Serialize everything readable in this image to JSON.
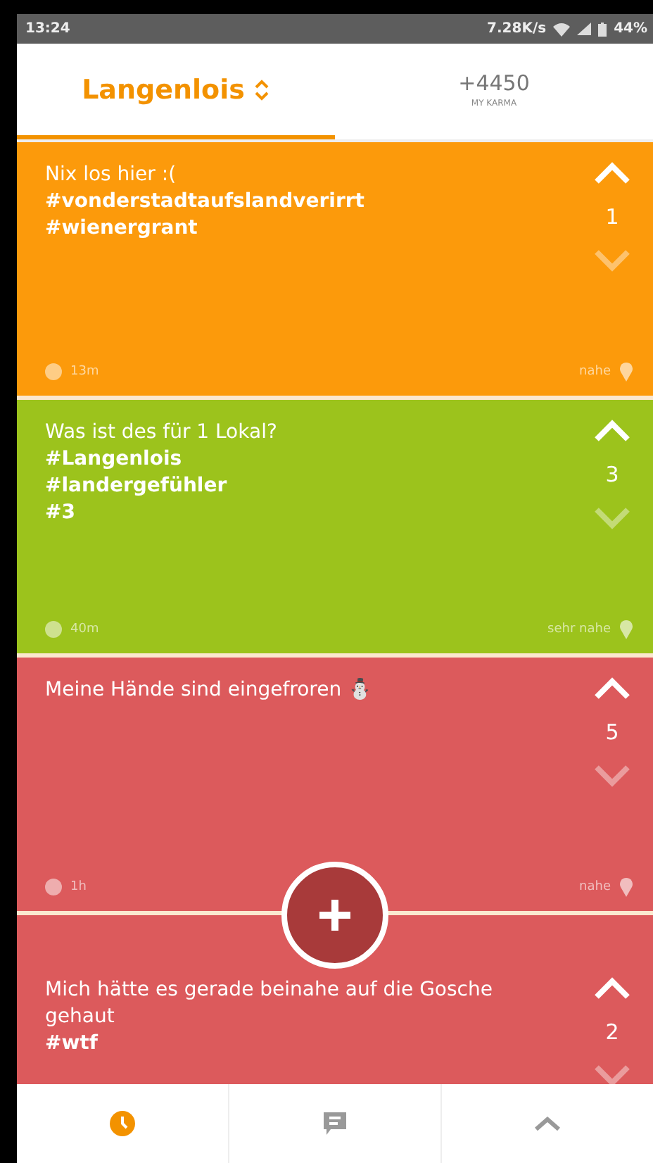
{
  "status_bar": {
    "time": "13:24",
    "speed": "7.28K/s",
    "battery": "44%"
  },
  "tabs": [
    {
      "kind": "location",
      "label": "Langenlois",
      "selected": true
    },
    {
      "kind": "karma",
      "label": "+4450",
      "sublabel": "MY KARMA",
      "selected": false
    }
  ],
  "posts": [
    {
      "color": "#fc9a0b",
      "lines": [
        {
          "text": "Nix los hier :(",
          "bold": false
        },
        {
          "text": "#vonderstadtaufslandverirrt",
          "bold": true
        },
        {
          "text": "#wienergrant",
          "bold": true
        }
      ],
      "votes": "1",
      "time": "13m",
      "distance": "nahe"
    },
    {
      "color": "#9cc31c",
      "lines": [
        {
          "text": "Was ist des für 1 Lokal?",
          "bold": false
        },
        {
          "text": "#Langenlois",
          "bold": true
        },
        {
          "text": "#landergefühler",
          "bold": true
        },
        {
          "text": "#3",
          "bold": true
        }
      ],
      "votes": "3",
      "time": "40m",
      "distance": "sehr nahe"
    },
    {
      "color": "#dc5a5c",
      "lines": [
        {
          "text": "Meine Hände sind eingefroren ⛄",
          "bold": false
        }
      ],
      "votes": "5",
      "time": "1h",
      "distance": "nahe"
    },
    {
      "color": "#dc5a5c",
      "lines": [
        {
          "text": "Mich hätte es gerade beinahe auf die Gosche gehaut",
          "bold": false
        },
        {
          "text": "#wtf",
          "bold": true
        }
      ],
      "votes": "2"
    }
  ],
  "nav": [
    {
      "kind": "recent",
      "selected": true
    },
    {
      "kind": "chat",
      "selected": false
    },
    {
      "kind": "top",
      "selected": false
    }
  ]
}
